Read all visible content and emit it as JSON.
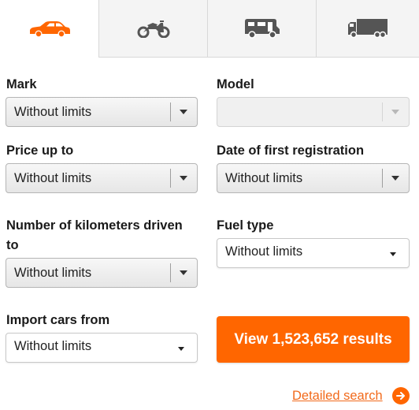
{
  "tabs": [
    {
      "name": "car",
      "icon": "car-icon",
      "active": true,
      "color": "#ff6600"
    },
    {
      "name": "motorcycle",
      "icon": "motorcycle-icon",
      "active": false
    },
    {
      "name": "camper",
      "icon": "camper-van-icon",
      "active": false
    },
    {
      "name": "truck",
      "icon": "truck-icon",
      "active": false
    }
  ],
  "form": {
    "mark": {
      "label": "Mark",
      "value": "Without limits"
    },
    "model": {
      "label": "Model",
      "value": "",
      "disabled": true
    },
    "price": {
      "label": "Price up to",
      "value": "Without limits"
    },
    "first_registration": {
      "label": "Date of first registration",
      "value": "Without limits"
    },
    "kilometers": {
      "label_line1": "Number of kilometers driven",
      "label_line2": "to",
      "value": "Without limits"
    },
    "fuel": {
      "label": "Fuel type",
      "value": "Without limits"
    },
    "import": {
      "label": "Import cars from",
      "value": "Without limits"
    }
  },
  "actions": {
    "view_results": "View 1,523,652 results",
    "detailed_search": "Detailed search"
  },
  "colors": {
    "accent": "#ff6600",
    "link": "#f26a1b"
  }
}
